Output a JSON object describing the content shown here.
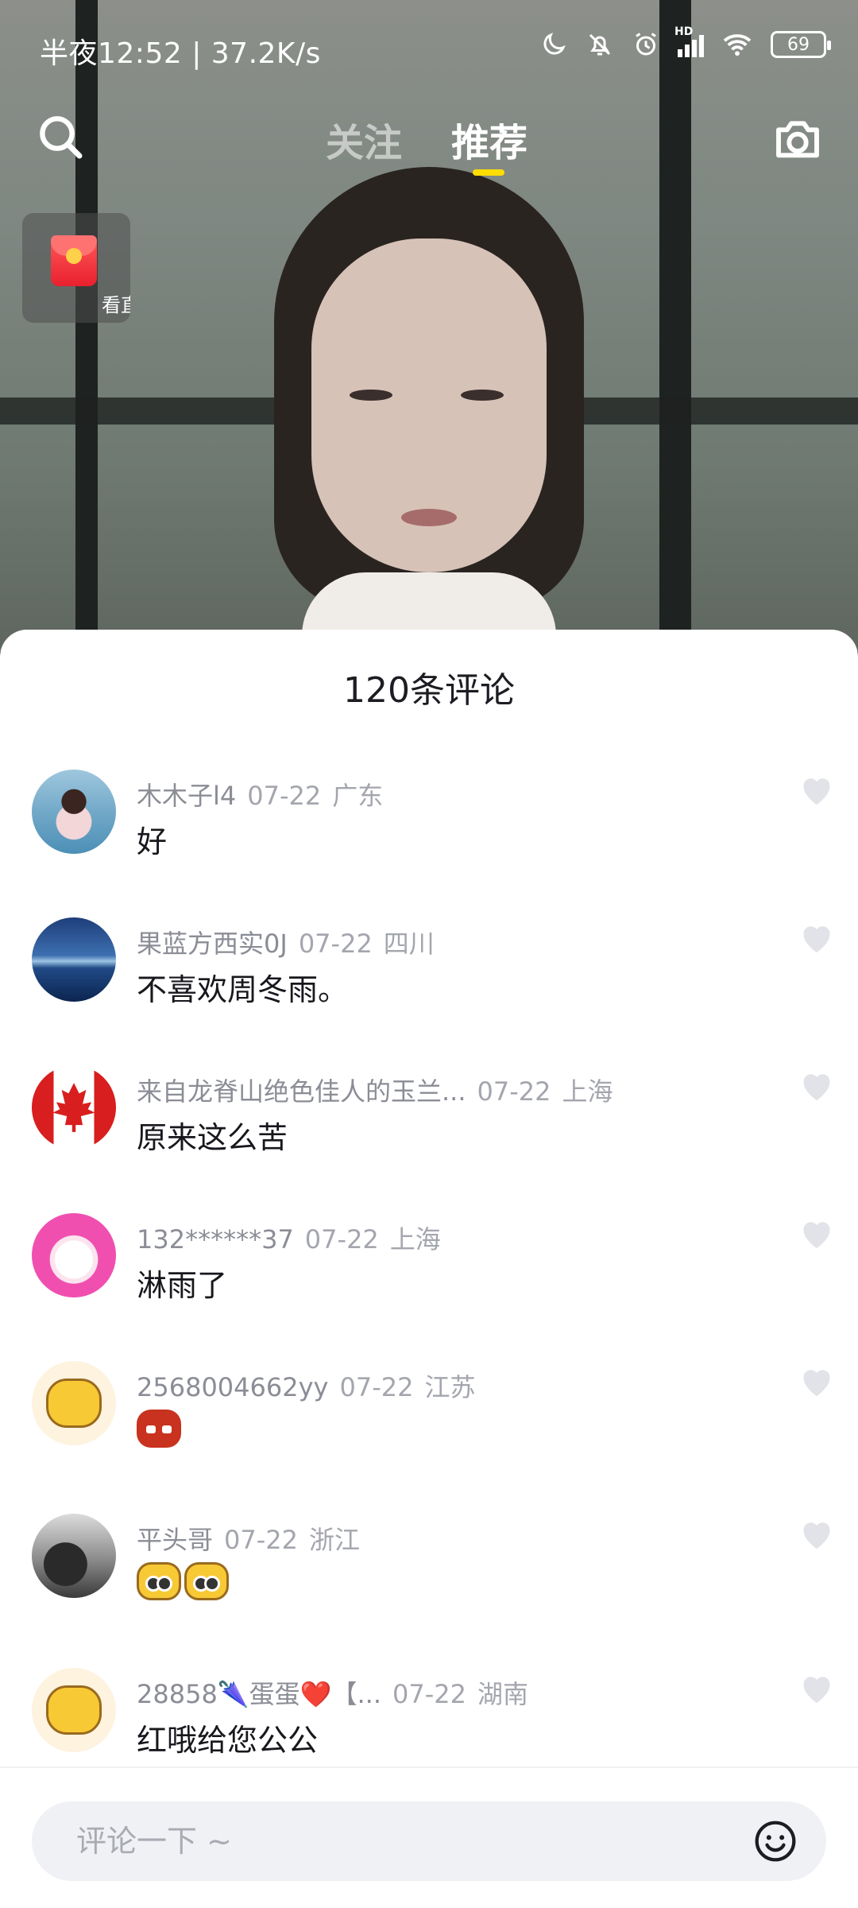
{
  "status_bar": {
    "time_speed": "半夜12:52 | 37.2K/s",
    "network_label": "HD",
    "battery": "69"
  },
  "top_nav": {
    "tabs": [
      {
        "label": "关注",
        "active": false
      },
      {
        "label": "推荐",
        "active": true
      }
    ],
    "accent_color": "#ffdd00"
  },
  "red_packet": {
    "label": "看直"
  },
  "comments_sheet": {
    "title": "120条评论",
    "comments": [
      {
        "user": "木木子l4",
        "date": "07-22",
        "location": "广东",
        "text": "好",
        "avatar": "photo-girl"
      },
      {
        "user": "果蓝方西实0J",
        "date": "07-22",
        "location": "四川",
        "text": "不喜欢周冬雨。",
        "avatar": "photo-sea"
      },
      {
        "user": "来自龙脊山绝色佳人的玉兰...",
        "date": "07-22",
        "location": "上海",
        "text": "原来这么苦",
        "avatar": "canada-flag"
      },
      {
        "user": "132******37",
        "date": "07-22",
        "location": "上海",
        "text": "淋雨了",
        "avatar": "pink-cat"
      },
      {
        "user": "2568004662yy",
        "date": "07-22",
        "location": "江苏",
        "text": "",
        "emojis": [
          "angry-face"
        ],
        "avatar": "raccoon-cartoon"
      },
      {
        "user": "平头哥",
        "date": "07-22",
        "location": "浙江",
        "text": "",
        "emojis": [
          "raccoon-face",
          "raccoon-face"
        ],
        "avatar": "photo-car"
      },
      {
        "user": "28858🌂蛋蛋❤️【...",
        "date": "07-22",
        "location": "湖南",
        "text": "红哦给您公公",
        "avatar": "raccoon-cartoon"
      }
    ],
    "input_placeholder": "评论一下 ~"
  },
  "icons": [
    "search-icon",
    "camera-icon",
    "heart-icon",
    "emoji-icon",
    "moon-icon",
    "bell-off-icon",
    "alarm-icon",
    "signal-icon",
    "wifi-icon",
    "battery-icon"
  ]
}
